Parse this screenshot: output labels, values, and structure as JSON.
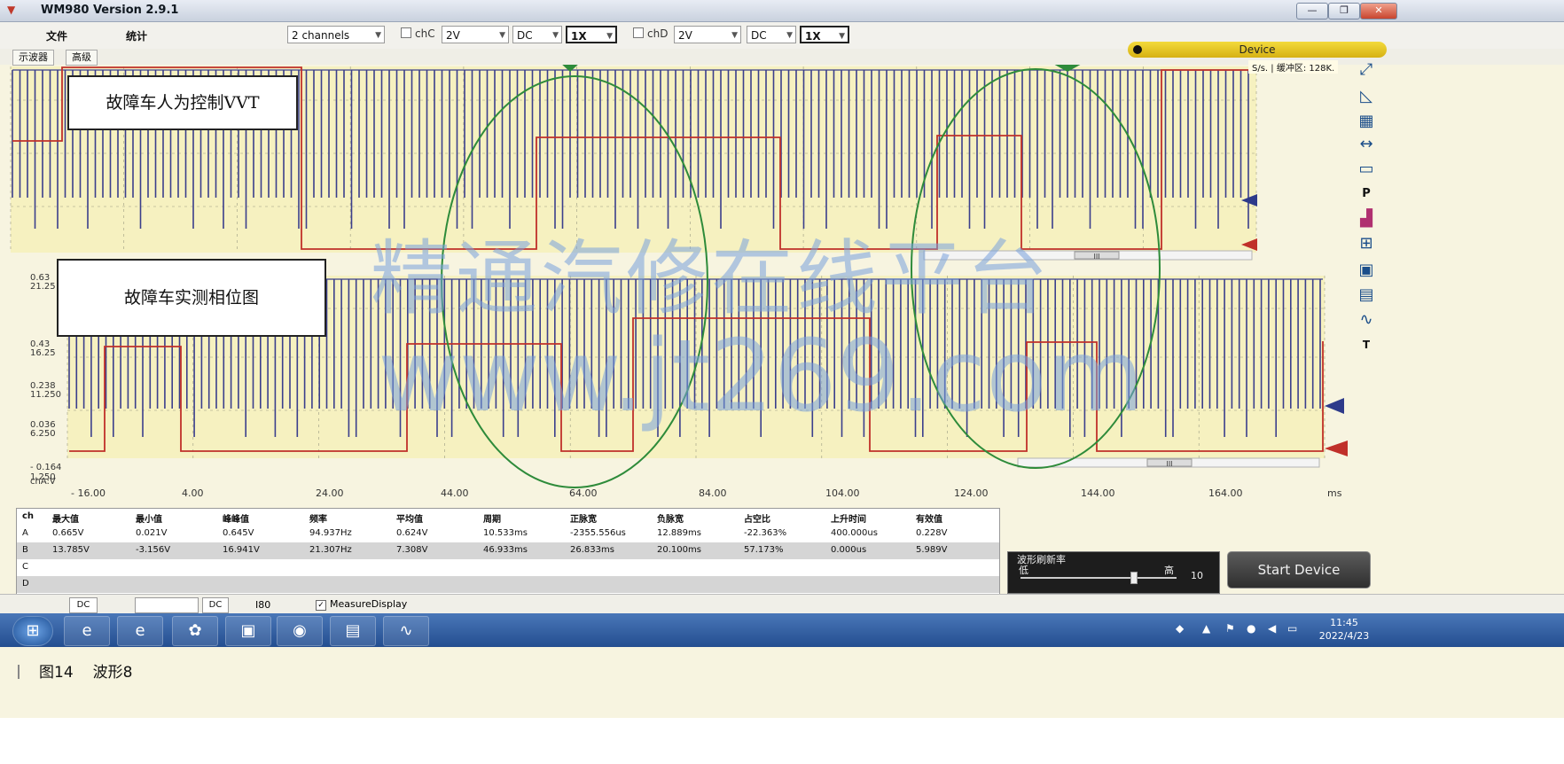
{
  "window": {
    "title": "WM980  Version 2.9.1",
    "min_label": "—",
    "max_label": "❐",
    "close_label": "✕"
  },
  "menu": {
    "file": "文件",
    "stats": "统计"
  },
  "toolbar": {
    "channels": "2 channels",
    "chc_label": "chC",
    "chc_volt": "2V",
    "chc_coupling": "DC",
    "chc_probe": "1X",
    "chd_label": "chD",
    "chd_volt": "2V",
    "chd_coupling": "DC",
    "chd_probe": "1X"
  },
  "tabs": {
    "scope": "示波器",
    "advanced": "高级"
  },
  "device": {
    "label": "Device",
    "buffer": "S/s. | 缓冲区: 128K."
  },
  "annotations": {
    "top": "故障车人为控制VVT",
    "bottom": "故障车实测相位图"
  },
  "scope": {
    "channel_label": "chA:V",
    "x_unit": "ms",
    "x_ticks": [
      "- 16.00",
      "4.00",
      "24.00",
      "44.00",
      "64.00",
      "84.00",
      "104.00",
      "124.00",
      "144.00",
      "164.00"
    ],
    "y_ticks": [
      {
        "a": "0.63",
        "b": "21.25"
      },
      {
        "a": "0.43",
        "b": "16.25"
      },
      {
        "a": "0.238",
        "b": "11.250"
      },
      {
        "a": "0.036",
        "b": "6.250"
      },
      {
        "a": "- 0.164",
        "b": "1.250"
      }
    ],
    "scroll_label": "III",
    "colors": {
      "grid_bg": "#f6f1c0",
      "chA": "#3b3f8c",
      "chB": "#c0302a",
      "ellipse": "#2e8b3a"
    }
  },
  "watermark": {
    "line1": "精通汽修在线平台",
    "line2": "www.jt269.com"
  },
  "measure": {
    "headers": [
      "ch",
      "最大值",
      "最小值",
      "峰峰值",
      "频率",
      "平均值",
      "周期",
      "正脉宽",
      "负脉宽",
      "占空比",
      "上升时间",
      "有效值"
    ],
    "rows": [
      [
        "A",
        "0.665V",
        "0.021V",
        "0.645V",
        "94.937Hz",
        "0.624V",
        "10.533ms",
        "-2355.556us",
        "12.889ms",
        "-22.363%",
        "400.000us",
        "0.228V"
      ],
      [
        "B",
        "13.785V",
        "-3.156V",
        "16.941V",
        "21.307Hz",
        "7.308V",
        "46.933ms",
        "26.833ms",
        "20.100ms",
        "57.173%",
        "0.000us",
        "5.989V"
      ],
      [
        "C",
        "",
        "",
        "",
        "",
        "",
        "",
        "",
        "",
        "",
        "",
        ""
      ],
      [
        "D",
        "",
        "",
        "",
        "",
        "",
        "",
        "",
        "",
        "",
        "",
        ""
      ]
    ]
  },
  "refresh": {
    "title": "波形刷新率",
    "low": "低",
    "high": "高",
    "value": "10",
    "level": 0.72
  },
  "start_button": "Start Device",
  "bottombar": {
    "dc1": "DC",
    "dc2": "DC",
    "value": "I80",
    "measure_display": "MeasureDisplay"
  },
  "taskbar": {
    "time": "11:45",
    "date": "2022/4/23"
  },
  "caption": {
    "figure": "图14",
    "name": "波形8"
  }
}
